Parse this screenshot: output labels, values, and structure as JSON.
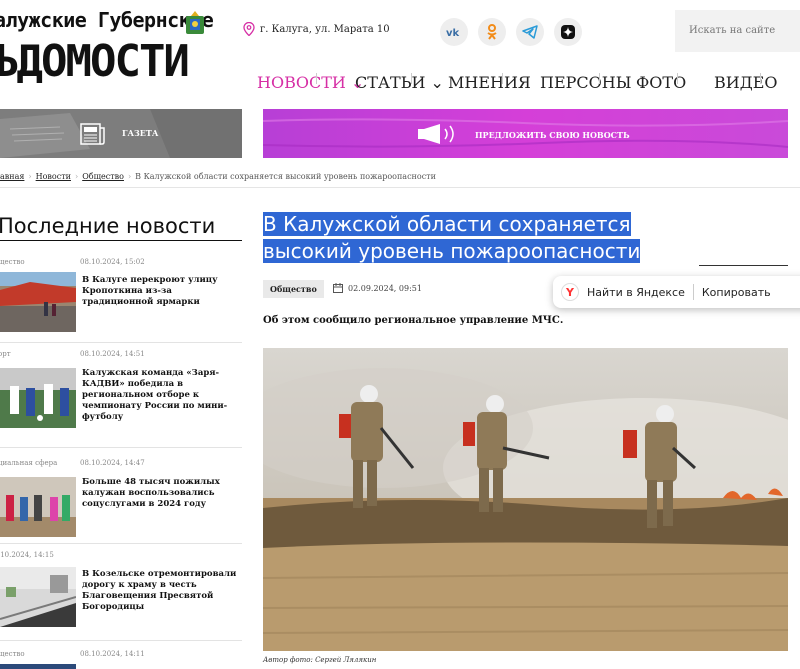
{
  "header": {
    "logo_top": "алужские Губернские",
    "logo_main": "ЪДОМОСТИ",
    "address": "г. Калуга, ул. Марата 10",
    "search_placeholder": "Искать на сайте",
    "socials": [
      "vk-icon",
      "odnoklassniki-icon",
      "telegram-icon",
      "zen-icon"
    ]
  },
  "nav": {
    "items": [
      {
        "label": "НОВОСТИ",
        "dropdown": true,
        "active": true
      },
      {
        "label": "СТАТЬИ",
        "dropdown": true,
        "active": false
      },
      {
        "label": "МНЕНИЯ",
        "dropdown": false,
        "active": false
      },
      {
        "label": "ПЕРСОНЫ",
        "dropdown": false,
        "active": false
      },
      {
        "label": "ФОТО",
        "dropdown": false,
        "active": false
      },
      {
        "label": "ВИДЕО",
        "dropdown": false,
        "active": false
      }
    ],
    "chevron": "⌄"
  },
  "banners": {
    "gazeta": "ГАЗЕТА",
    "suggest": "ПРЕДЛОЖИТЬ СВОЮ НОВОСТЬ"
  },
  "breadcrumb": {
    "home": "авная",
    "news": "Новости",
    "society": "Общество",
    "current": "В Калужской области сохраняется высокий уровень пожароопасности",
    "sep": "›"
  },
  "sidebar": {
    "title": "Последние новости",
    "items": [
      {
        "category": "щество",
        "date": "08.10.2024, 15:02",
        "headline": "В Калуге перекроют улицу Кропоткина из-за традиционной ярмарки"
      },
      {
        "category": "орт",
        "date": "08.10.2024, 14:51",
        "headline": "Калужская команда «Заря-КАДВИ» победила в региональном отборе к чемпионату России по мини-футболу"
      },
      {
        "category": "циальная сфера",
        "date": "08.10.2024, 14:47",
        "headline": "Больше 48 тысяч пожилых калужан воспользовались соцуслугами в 2024 году"
      },
      {
        "category": ".10.2024, 14:15",
        "date": "",
        "headline": "В Козельске отремонтировали дорогу к храму в честь Благовещения Пресвятой Богородицы"
      },
      {
        "category": "щество",
        "date": "08.10.2024, 14:11",
        "headline": ""
      }
    ]
  },
  "article": {
    "title_line1": "В Калужской области сохраняется",
    "title_line2": "высокий уровень пожароопасности",
    "tag": "Общество",
    "date": "02.09.2024, 09:51",
    "lead": "Об этом сообщило региональное управление МЧС.",
    "photo_caption": "Автор фото: Сергей Лялякин"
  },
  "yandex_popup": {
    "logo": "Y",
    "find": "Найти в Яндексе",
    "copy": "Копировать"
  },
  "colors": {
    "accent": "#d62fa5",
    "highlight": "#2f67d4",
    "banner": "#cc44d8"
  }
}
